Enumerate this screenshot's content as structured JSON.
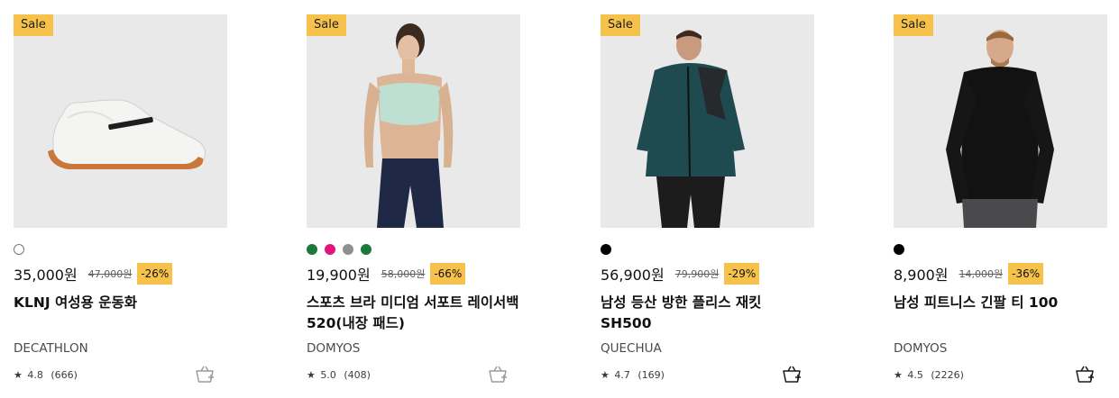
{
  "products": [
    {
      "badge": "Sale",
      "swatches": [
        "#ffffff"
      ],
      "price": "35,000원",
      "original_price": "47,000원",
      "discount": "-26%",
      "name": "KLNJ 여성용 운동화",
      "brand": "DECATHLON",
      "rating": "4.8",
      "reviews": "(666)",
      "image_icon": "sneaker-image"
    },
    {
      "badge": "Sale",
      "swatches": [
        "#1a7a3c",
        "#e0157a",
        "#8f8f8f",
        "#1a7a3c"
      ],
      "price": "19,900원",
      "original_price": "58,000원",
      "discount": "-66%",
      "name": "스포츠 브라 미디엄 서포트 레이서백 520(내장 패드)",
      "brand": "DOMYOS",
      "rating": "5.0",
      "reviews": "(408)",
      "image_icon": "sports-bra-image"
    },
    {
      "badge": "Sale",
      "swatches": [
        "#000000"
      ],
      "price": "56,900원",
      "original_price": "79,900원",
      "discount": "-29%",
      "name": "남성 등산 방한 플리스 재킷 SH500",
      "brand": "QUECHUA",
      "rating": "4.7",
      "reviews": "(169)",
      "image_icon": "fleece-jacket-image"
    },
    {
      "badge": "Sale",
      "swatches": [
        "#000000"
      ],
      "price": "8,900원",
      "original_price": "14,000원",
      "discount": "-36%",
      "name": "남성 피트니스 긴팔 티 100",
      "brand": "DOMYOS",
      "rating": "4.5",
      "reviews": "(2226)",
      "image_icon": "long-sleeve-tee-image"
    }
  ],
  "icons": {
    "star": "★",
    "cart": "cart-add-icon"
  },
  "colors": {
    "sale_badge": "#f7c24b",
    "image_bg": "#e9e9ea"
  }
}
